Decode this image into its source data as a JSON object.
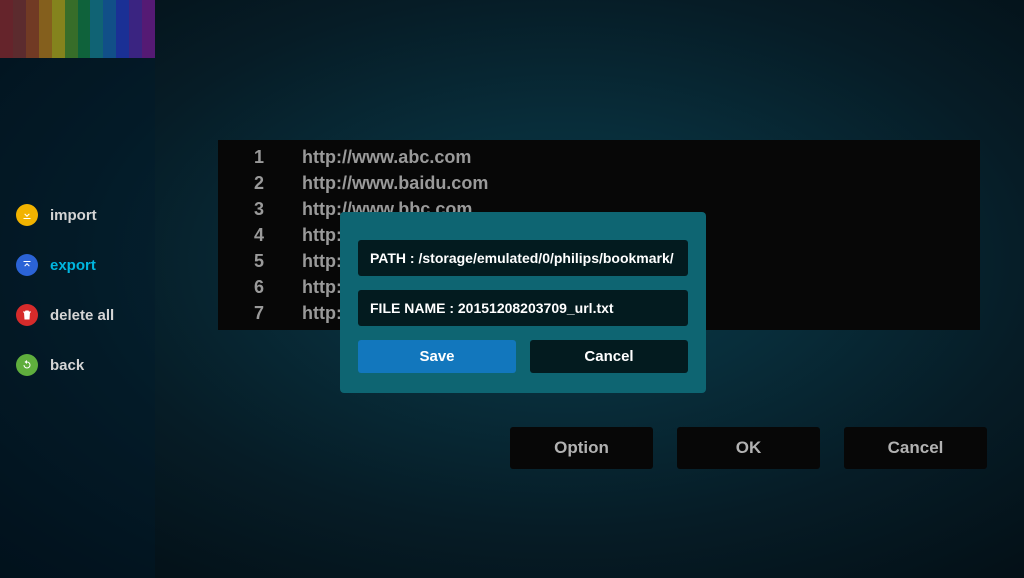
{
  "rainbow_colors": [
    "#a42b2b",
    "#95362f",
    "#b64e1f",
    "#d68a14",
    "#d6c414",
    "#5aa028",
    "#198f45",
    "#1a90a0",
    "#1c70c0",
    "#2a3ed6",
    "#5e2bb5",
    "#8a1aa0"
  ],
  "sidebar": {
    "items": [
      {
        "label": "import",
        "icon": "import"
      },
      {
        "label": "export",
        "icon": "export",
        "active": true
      },
      {
        "label": "delete all",
        "icon": "delete"
      },
      {
        "label": "back",
        "icon": "back"
      }
    ]
  },
  "urls": [
    {
      "n": "1",
      "u": "http://www.abc.com"
    },
    {
      "n": "2",
      "u": "http://www.baidu.com"
    },
    {
      "n": "3",
      "u": "http://www.bbc.com"
    },
    {
      "n": "4",
      "u": "http:"
    },
    {
      "n": "5",
      "u": "http:"
    },
    {
      "n": "6",
      "u": "http:"
    },
    {
      "n": "7",
      "u": "http:"
    }
  ],
  "dialog": {
    "path_label": "PATH :",
    "path_value": "/storage/emulated/0/philips/bookmark/",
    "file_label": "FILE NAME :",
    "file_value": "20151208203709_url.txt",
    "save": "Save",
    "cancel": "Cancel"
  },
  "bottom": {
    "option": "Option",
    "ok": "OK",
    "cancel": "Cancel"
  }
}
